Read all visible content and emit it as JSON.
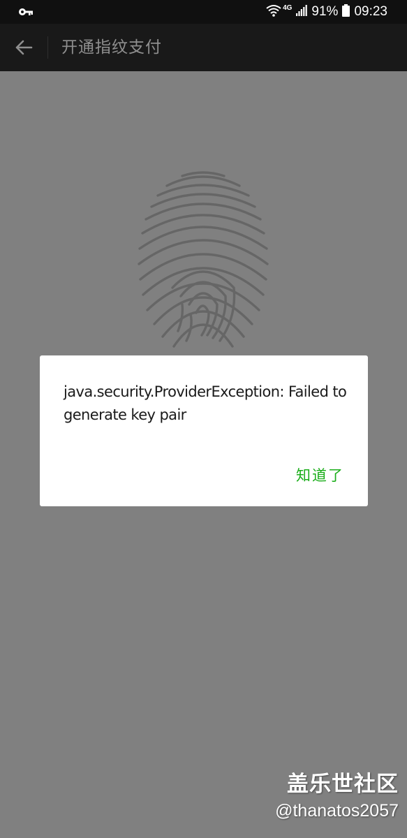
{
  "status_bar": {
    "network": "4G",
    "battery": "91%",
    "time": "09:23",
    "icons": [
      "key-icon",
      "wifi-icon",
      "signal-icon",
      "battery-icon"
    ]
  },
  "toolbar": {
    "title": "开通指纹支付",
    "back_icon": "arrow-left-icon"
  },
  "main": {
    "icon": "fingerprint-icon"
  },
  "dialog": {
    "message": "java.security.ProviderException: Failed to generate key pair",
    "ok_label": "知道了",
    "ok_color": "#1aad19"
  },
  "watermark": {
    "line1": "盖乐世社区",
    "line2": "@thanatos2057"
  },
  "colors": {
    "overlay_background": "#808080",
    "toolbar_background": "#191919",
    "status_bar_background": "#101010"
  }
}
